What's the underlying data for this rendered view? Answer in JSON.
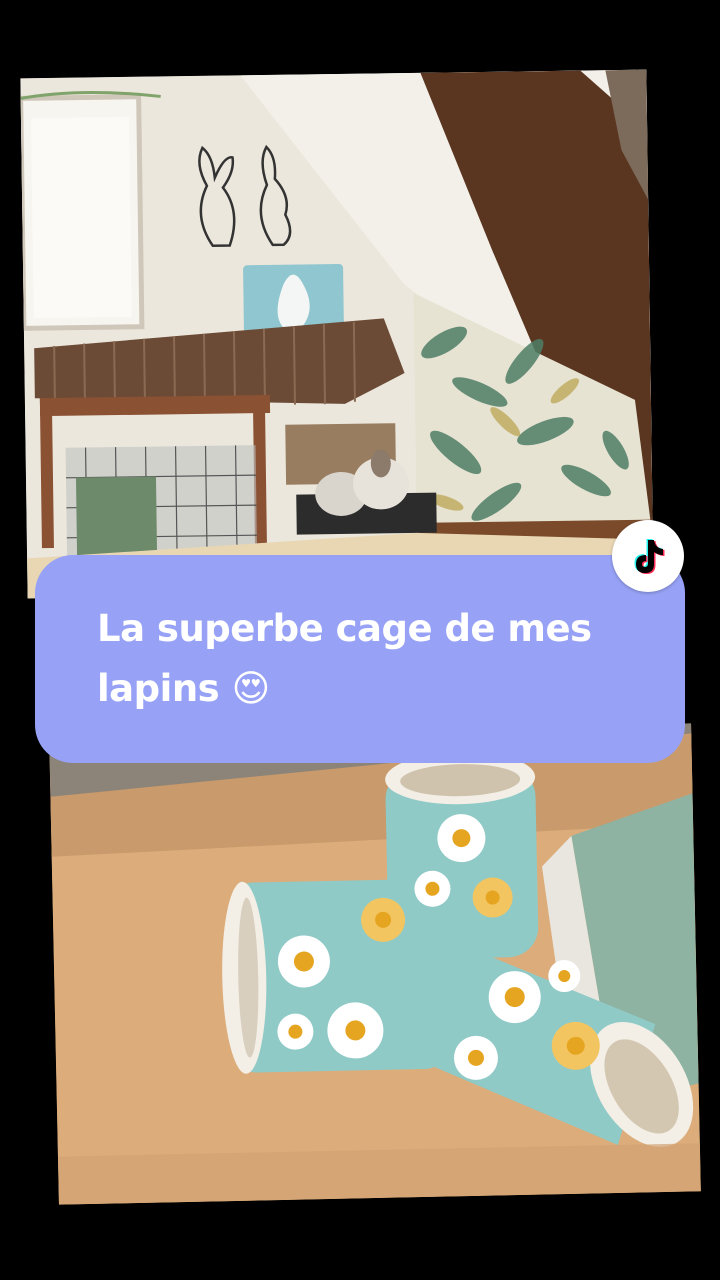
{
  "caption": {
    "text": "La superbe cage de mes lapins 😍"
  },
  "badge": {
    "icon": "tiktok-icon"
  },
  "photos": {
    "top": {
      "icon": "rabbit-room-photo"
    },
    "bottom": {
      "icon": "daisy-tunnel-photo"
    }
  },
  "colors": {
    "caption_background": "#97a2f6",
    "caption_text": "#ffffff",
    "page_background": "#000000"
  }
}
